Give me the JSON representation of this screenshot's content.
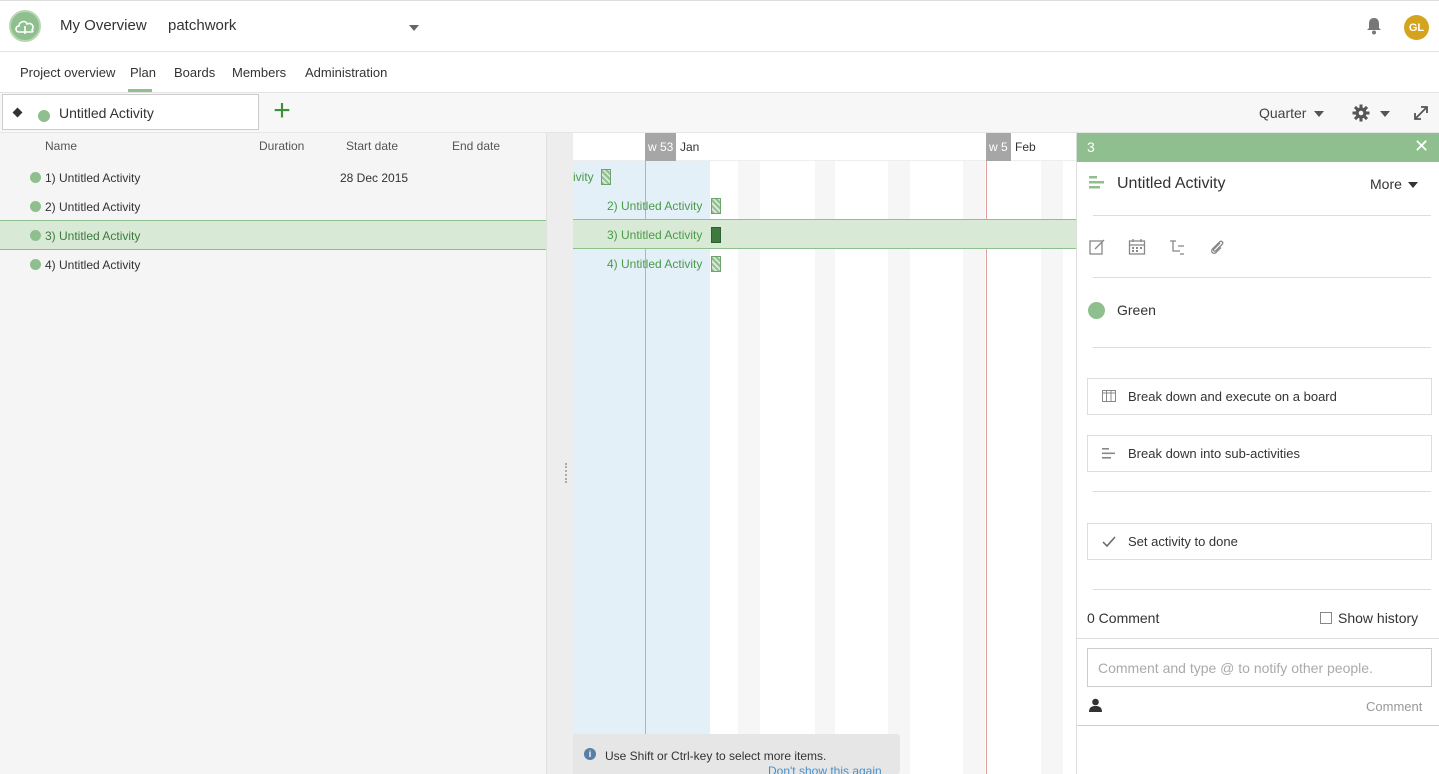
{
  "header": {
    "my_overview": "My Overview",
    "project": "patchwork",
    "avatar_initials": "GL"
  },
  "tabs": [
    "Project overview",
    "Plan",
    "Boards",
    "Members",
    "Administration"
  ],
  "active_tab": "Plan",
  "toolbar": {
    "activity_name": "Untitled Activity",
    "add_label": "+",
    "zoom": "Quarter"
  },
  "list": {
    "columns": [
      "Name",
      "Duration",
      "Start date",
      "End date"
    ],
    "rows": [
      {
        "name": "1)  Untitled Activity",
        "duration": "",
        "start": "28 Dec 2015",
        "end": ""
      },
      {
        "name": "2)  Untitled Activity",
        "duration": "",
        "start": "",
        "end": ""
      },
      {
        "name": "3)  Untitled Activity",
        "duration": "",
        "start": "",
        "end": ""
      },
      {
        "name": "4)  Untitled Activity",
        "duration": "",
        "start": "",
        "end": ""
      }
    ],
    "selected_index": 2
  },
  "gantt": {
    "weeks": [
      "w 53",
      "w 5"
    ],
    "months": [
      "Jan",
      "Feb"
    ],
    "labels": [
      "ivity",
      "2) Untitled Activity",
      "3) Untitled Activity",
      "4) Untitled Activity"
    ],
    "hint": "Use Shift or Ctrl-key to select more items.",
    "hint_dismiss": "Don't show this again"
  },
  "panel": {
    "number": "3",
    "close": "✕",
    "title": "Untitled Activity",
    "more": "More",
    "color_name": "Green",
    "color": "#8fbf8f",
    "actions": [
      "Break down and execute on a board",
      "Break down into sub-activities",
      "Set activity to done"
    ],
    "comment_count": "0 Comment",
    "show_history": "Show history",
    "comment_placeholder": "Comment and type @ to notify other people.",
    "comment_button": "Comment"
  }
}
